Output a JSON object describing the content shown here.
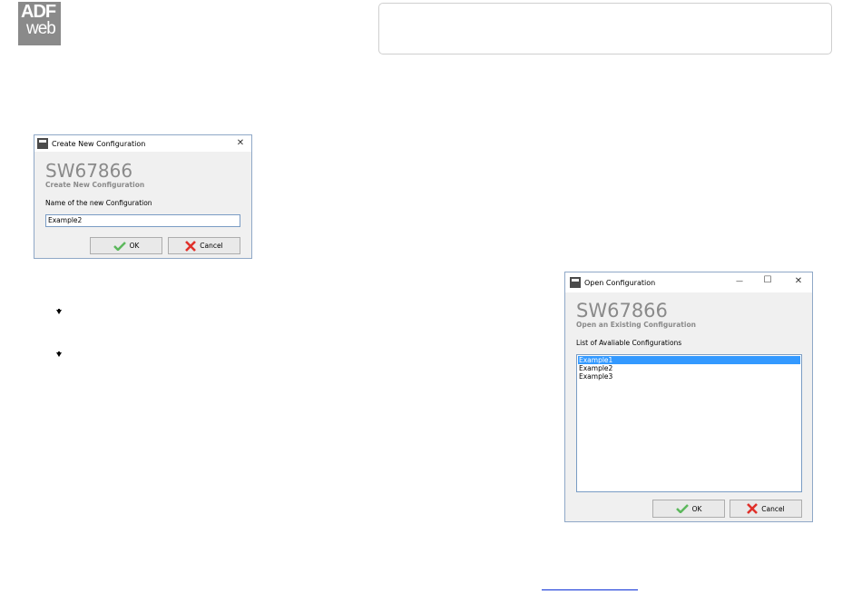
{
  "logo": {
    "line1": "ADF",
    "line2": "web"
  },
  "create_dialog": {
    "title": "Create New Configuration",
    "close_glyph": "✕",
    "heading": "SW67866",
    "subheading": "Create New Configuration",
    "name_label": "Name of the new Configuration",
    "name_value": "Example2",
    "ok_label": "OK",
    "cancel_label": "Cancel"
  },
  "open_dialog": {
    "title": "Open Configuration",
    "minimize_glyph": "—",
    "maximize_glyph": "☐",
    "close_glyph": "✕",
    "heading": "SW67866",
    "subheading": "Open an Existing Configuration",
    "list_label": "List of Avaliable Configurations",
    "items": [
      "Example1",
      "Example2",
      "Example3"
    ],
    "selected_index": 0,
    "ok_label": "OK",
    "cancel_label": "Cancel"
  },
  "colors": {
    "selection": "#3399ff",
    "ok_check": "#5cb85c",
    "cancel_x": "#e0302a",
    "link": "#0b2fd6"
  }
}
